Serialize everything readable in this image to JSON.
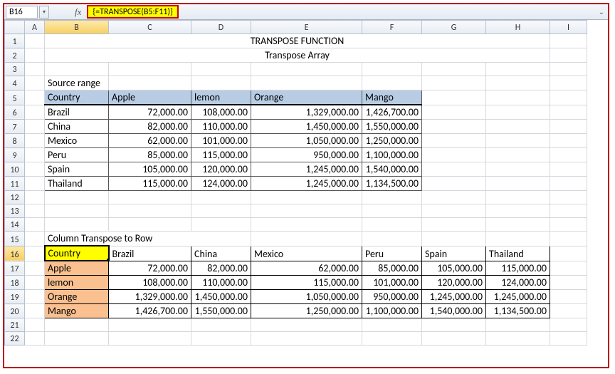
{
  "namebox": "B16",
  "fx_label": "fx",
  "formula": "{=TRANSPOSE(B5:F11)}",
  "columns": [
    "A",
    "B",
    "C",
    "D",
    "E",
    "F",
    "G",
    "H",
    "I"
  ],
  "rows": [
    "1",
    "2",
    "3",
    "4",
    "5",
    "6",
    "7",
    "8",
    "9",
    "10",
    "11",
    "12",
    "13",
    "14",
    "15",
    "16",
    "17",
    "18",
    "19",
    "20",
    "21",
    "22"
  ],
  "title": "TRANSPOSE FUNCTION",
  "subtitle": "Transpose Array",
  "source_range_label": "Source range",
  "column_transpose_label": "Column Transpose to Row",
  "source": {
    "headers": [
      "Country",
      "Apple",
      "lemon",
      "Orange",
      "Mango"
    ],
    "rows": [
      {
        "country": "Brazil",
        "apple": "72,000.00",
        "lemon": "108,000.00",
        "orange": "1,329,000.00",
        "mango": "1,426,700.00"
      },
      {
        "country": "China",
        "apple": "82,000.00",
        "lemon": "110,000.00",
        "orange": "1,450,000.00",
        "mango": "1,550,000.00"
      },
      {
        "country": "Mexico",
        "apple": "62,000.00",
        "lemon": "101,000.00",
        "orange": "1,050,000.00",
        "mango": "1,250,000.00"
      },
      {
        "country": "Peru",
        "apple": "85,000.00",
        "lemon": "115,000.00",
        "orange": "950,000.00",
        "mango": "1,100,000.00"
      },
      {
        "country": "Spain",
        "apple": "105,000.00",
        "lemon": "120,000.00",
        "orange": "1,245,000.00",
        "mango": "1,540,000.00"
      },
      {
        "country": "Thailand",
        "apple": "115,000.00",
        "lemon": "124,000.00",
        "orange": "1,245,000.00",
        "mango": "1,134,500.00"
      }
    ]
  },
  "transpose": {
    "headers": [
      "Country",
      "Brazil",
      "China",
      "Mexico",
      "Peru",
      "Spain",
      "Thailand"
    ],
    "rows": [
      {
        "label": "Apple",
        "v": [
          "72,000.00",
          "82,000.00",
          "62,000.00",
          "85,000.00",
          "105,000.00",
          "115,000.00"
        ]
      },
      {
        "label": "lemon",
        "v": [
          "108,000.00",
          "110,000.00",
          "115,000.00",
          "101,000.00",
          "120,000.00",
          "124,000.00"
        ]
      },
      {
        "label": "Orange",
        "v": [
          "1,329,000.00",
          "1,450,000.00",
          "1,050,000.00",
          "950,000.00",
          "1,245,000.00",
          "1,245,000.00"
        ]
      },
      {
        "label": "Mango",
        "v": [
          "1,426,700.00",
          "1,550,000.00",
          "1,250,000.00",
          "1,100,000.00",
          "1,540,000.00",
          "1,134,500.00"
        ]
      }
    ]
  }
}
